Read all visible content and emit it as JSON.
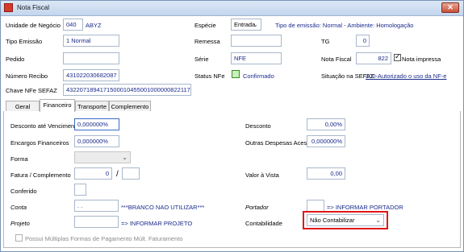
{
  "window": {
    "title": "Nota Fiscal",
    "close": "✕"
  },
  "header": {
    "unidade_label": "Unidade de Negócio",
    "unidade_code": "040",
    "unidade_name": "ABYZ",
    "especie_label": "Espécie",
    "especie_value": "Entrada",
    "tipo_emissao_info": "Tipo de emissão: Normal - Ambiente: Homologação",
    "tipo_emissao_label": "Tipo Emissão",
    "tipo_emissao_value": "1 Normal",
    "remessa_label": "Remessa",
    "tg_label": "TG",
    "tg_value": "0",
    "pedido_label": "Pedido",
    "serie_label": "Série",
    "serie_value": "NFE",
    "nota_fiscal_label": "Nota Fiscal",
    "nota_fiscal_value": "822",
    "nota_impressa_label": "Nota impressa",
    "numero_recibo_label": "Número Recibo",
    "numero_recibo_value": "431022030682087",
    "status_nfe_label": "Status NFe",
    "status_nfe_value": "Confirmado",
    "situacao_sefaz_label": "Situação na SEFAZ",
    "situacao_sefaz_link": "100-Autorizado o uso da NF-e",
    "chave_label": "Chave NFe SEFAZ",
    "chave_value": "43220718941715000104550010000008221177990970"
  },
  "tabs": [
    {
      "label": "Geral"
    },
    {
      "label": "Financeiro"
    },
    {
      "label": "Transporte"
    },
    {
      "label": "Complemento"
    }
  ],
  "financeiro": {
    "desconto_venc_label": "Desconto até Vencimento",
    "desconto_venc_value": "0,000000%",
    "desconto_label": "Desconto",
    "desconto_value": "0,00%",
    "encargos_label": "Encargos Financeiros",
    "encargos_value": "0,000000%",
    "outras_label": "Outras Despesas Acess.",
    "outras_value": "0,000000%",
    "forma_label": "Forma",
    "fatura_label": "Fatura / Complemento",
    "fatura_value": "0",
    "fatura_sep": "/",
    "valor_vista_label": "Valor à Vista",
    "valor_vista_value": "0,00",
    "conferido_label": "Conferido",
    "conta_label": "Conta",
    "conta_value": ". .",
    "conta_info": "***BRANCO NAO UTILIZAR***",
    "portador_label": "Portador",
    "portador_info": "=> INFORMAR PORTADOR",
    "projeto_label": "Projeto",
    "projeto_info": "=> INFORMAR PROJETO",
    "contabilidade_label": "Contabilidade",
    "contabilidade_value": "Não Contabilizar",
    "multiplas_label": "Possui Múltiplas Formas de Pagamento Múlt. Faturamento"
  }
}
